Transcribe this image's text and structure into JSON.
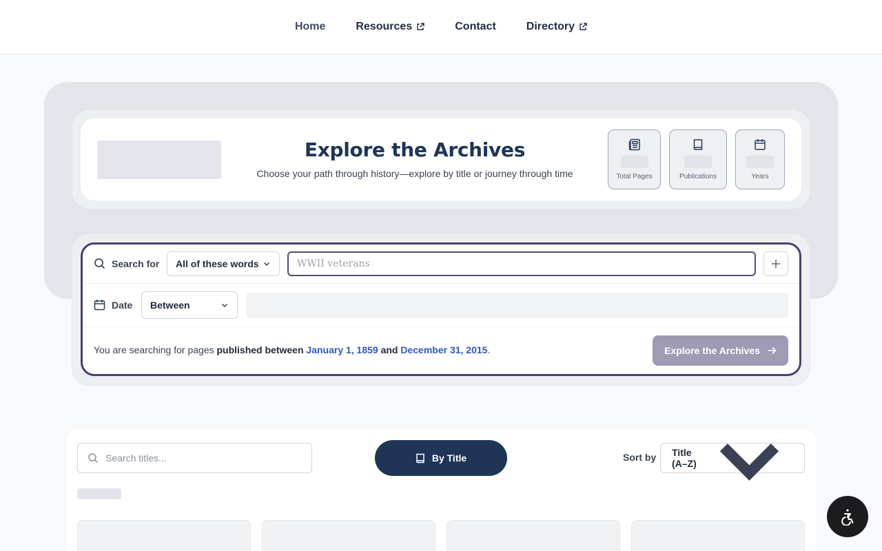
{
  "nav": {
    "items": [
      {
        "label": "Home",
        "external": false,
        "active": true
      },
      {
        "label": "Resources",
        "external": true
      },
      {
        "label": "Contact",
        "external": false
      },
      {
        "label": "Directory",
        "external": true
      }
    ]
  },
  "hero": {
    "title": "Explore the Archives",
    "subtitle": "Choose your path through history—explore by title or journey through time",
    "stats": [
      {
        "label": "Total Pages",
        "icon": "newspaper-icon"
      },
      {
        "label": "Publications",
        "icon": "book-icon"
      },
      {
        "label": "Years",
        "icon": "calendar-icon"
      }
    ]
  },
  "search": {
    "search_for_label": "Search for",
    "mode_value": "All of these words",
    "keyword_placeholder": "WWII veterans",
    "date_label": "Date",
    "date_mode_value": "Between",
    "summary": {
      "prefix": "You are searching for pages ",
      "published": "published between",
      "start": "January 1, 1859",
      "and": "and",
      "end": "December 31, 2015",
      "suffix": "."
    },
    "submit_label": "Explore the Archives"
  },
  "browse": {
    "search_placeholder": "Search titles...",
    "view_button_label": "By Title",
    "sort_label": "Sort by",
    "sort_value": "Title (A–Z)"
  },
  "colors": {
    "primary": "#1e3556",
    "accent_border": "#4b3f6e",
    "date_link": "#2b58c6",
    "submit_disabled": "#9f9bb5"
  }
}
